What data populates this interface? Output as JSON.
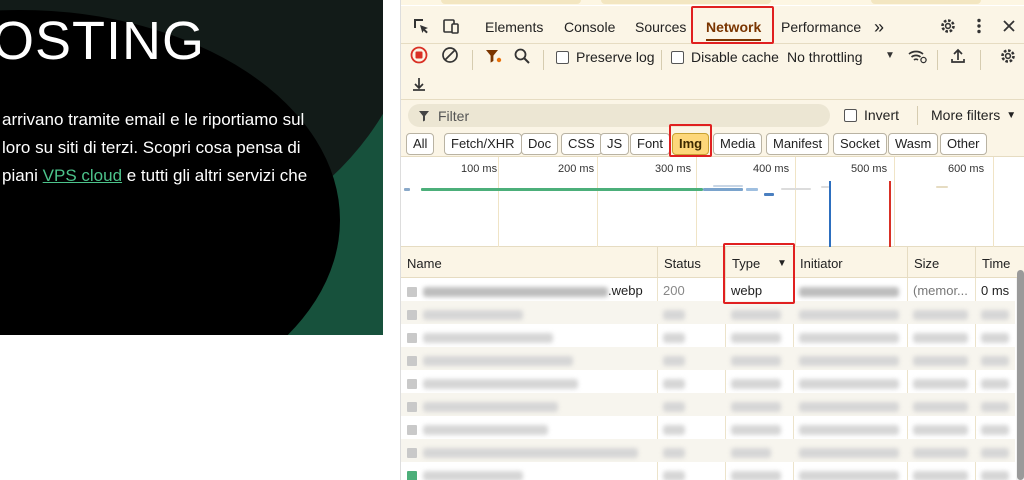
{
  "website": {
    "title": "OSTING",
    "paragraph_lines": [
      "arrivano tramite email e le riportiamo sul",
      "loro su siti di terzi. Scopri cosa pensa di"
    ],
    "line3_prefix": "piani ",
    "line3_link": "VPS cloud",
    "line3_suffix": " e tutti gli altri servizi che"
  },
  "devtools": {
    "tabs": [
      "Elements",
      "Console",
      "Sources",
      "Network",
      "Performance"
    ],
    "active_tab": "Network",
    "more_tabs_glyph": "»",
    "toolbar": {
      "preserve_log": "Preserve log",
      "disable_cache": "Disable cache",
      "throttling": "No throttling"
    },
    "filter": {
      "placeholder": "Filter",
      "invert": "Invert",
      "more_filters": "More filters"
    },
    "type_filters": [
      "All",
      "Fetch/XHR",
      "Doc",
      "CSS",
      "JS",
      "Font",
      "Img",
      "Media",
      "Manifest",
      "Socket",
      "Wasm",
      "Other"
    ],
    "active_type_filter": "Img",
    "timeline_ticks": [
      "100 ms",
      "200 ms",
      "300 ms",
      "400 ms",
      "500 ms",
      "600 ms"
    ],
    "columns": [
      "Name",
      "Status",
      "Type",
      "Initiator",
      "Size",
      "Time"
    ],
    "sort_column": "Type",
    "first_row": {
      "name_suffix": ".webp",
      "status": "200",
      "type": "webp",
      "size": "(memor...",
      "time": "0 ms"
    },
    "colors": {
      "active_accent": "#7a3500",
      "highlight_box": "#e02020",
      "active_chip": "#fdd77a"
    }
  }
}
